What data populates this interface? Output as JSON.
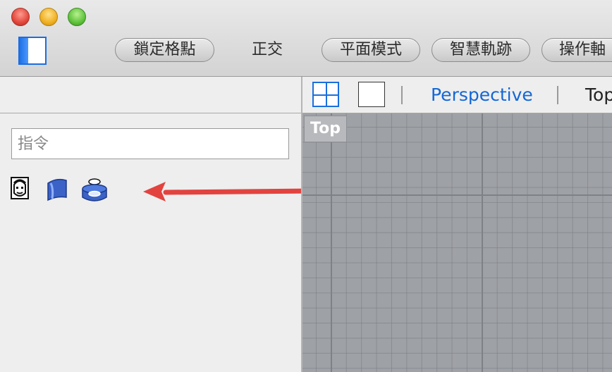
{
  "toolbar": {
    "snap_button": "鎖定格點",
    "ortho_label": "正交",
    "planar_button": "平面模式",
    "smarttrack_button": "智慧軌跡",
    "gumball_button": "操作軸"
  },
  "left_panel": {
    "command_placeholder": "指令",
    "tool_icons": [
      "face-icon",
      "surface-icon",
      "cylinder-hole-icon"
    ]
  },
  "viewport": {
    "tabs": {
      "perspective": "Perspective",
      "top": "Top"
    },
    "active_view_label": "Top"
  },
  "colors": {
    "accent_blue": "#1467d6",
    "arrow_red": "#e2433f",
    "viewport_bg": "#9ea1a6"
  }
}
